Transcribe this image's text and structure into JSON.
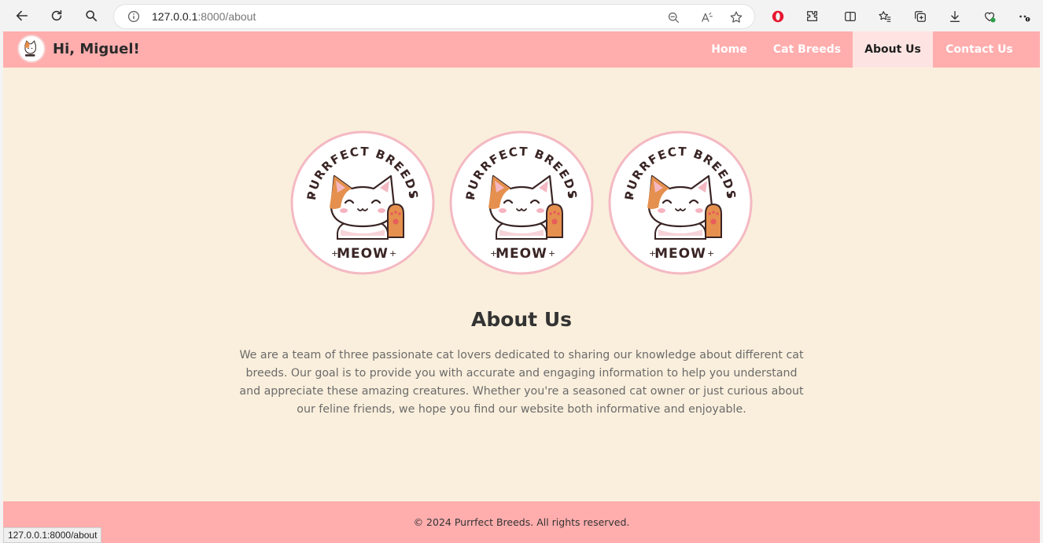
{
  "browser": {
    "url_host": "127.0.0.1",
    "url_path": ":8000/about",
    "status_url": "127.0.0.1:8000/about",
    "icons": [
      "back-icon",
      "refresh-icon",
      "search-icon",
      "info-icon",
      "zoom-out-icon",
      "read-aloud-icon",
      "favorite-star-icon",
      "opera-icon",
      "extensions-icon",
      "split-screen-icon",
      "favorites-icon",
      "collections-icon",
      "download-icon",
      "health-icon",
      "more-icon"
    ]
  },
  "header": {
    "greeting": "Hi, Miguel!",
    "nav": [
      {
        "label": "Home",
        "active": false
      },
      {
        "label": "Cat Breeds",
        "active": false
      },
      {
        "label": "About Us",
        "active": true
      },
      {
        "label": "Contact Us",
        "active": false
      }
    ]
  },
  "badge": {
    "top_text": "PURRFECT BREEDS",
    "bottom_text": "MEOW"
  },
  "main": {
    "title": "About Us",
    "paragraph": "We are a team of three passionate cat lovers dedicated to sharing our knowledge about different cat breeds. Our goal is to provide you with accurate and engaging information to help you understand and appreciate these amazing creatures. Whether you're a seasoned cat owner or just curious about our feline friends, we hope you find our website both informative and enjoyable."
  },
  "footer": {
    "text": "© 2024 Purrfect Breeds. All rights reserved."
  },
  "colors": {
    "nav_bg": "#ffadad",
    "page_bg": "#faefdc",
    "active_tab_bg": "#fde4e2",
    "badge_ring": "#f4b9c3"
  }
}
